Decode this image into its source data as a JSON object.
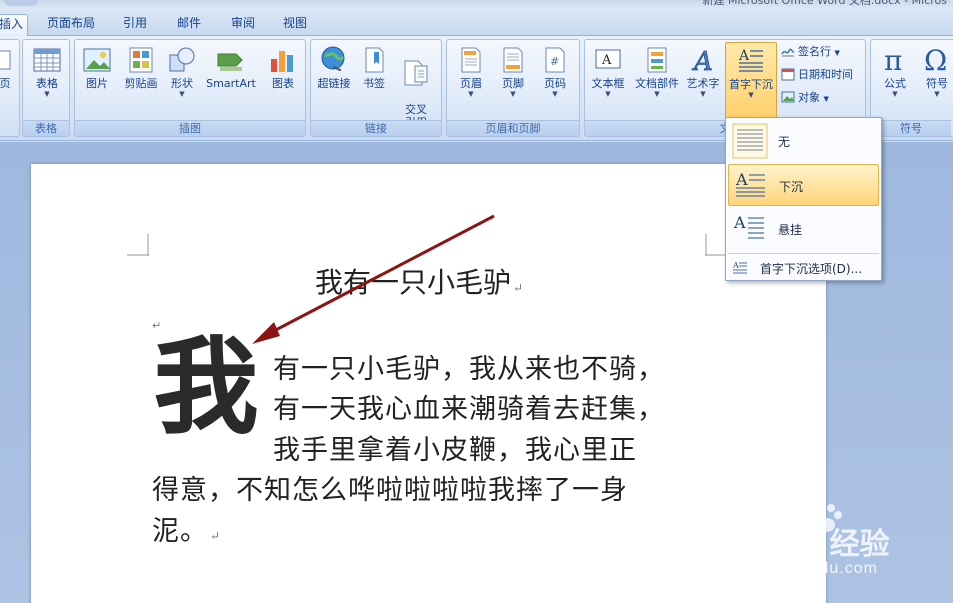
{
  "window": {
    "title": "新建 Microsoft Office Word 文档.docx - Micros"
  },
  "tabs": [
    {
      "label": "插入",
      "active": true
    },
    {
      "label": "页面布局"
    },
    {
      "label": "引用"
    },
    {
      "label": "邮件"
    },
    {
      "label": "审阅"
    },
    {
      "label": "视图"
    }
  ],
  "ribbon": {
    "groups": {
      "table": {
        "label": "表格",
        "buttons": [
          "表格"
        ]
      },
      "illustrations": {
        "label": "插图",
        "buttons": [
          "图片",
          "剪贴画",
          "形状",
          "SmartArt",
          "图表"
        ]
      },
      "links": {
        "label": "链接",
        "buttons": [
          "超链接",
          "书签",
          "交叉\n引用"
        ]
      },
      "header_footer": {
        "label": "页眉和页脚",
        "buttons": [
          "页眉",
          "页脚",
          "页码"
        ]
      },
      "text": {
        "label": "文",
        "buttons": [
          "文本框",
          "文档部件",
          "艺术字",
          "首字下沉"
        ],
        "small": [
          "签名行",
          "日期和时间",
          "对象"
        ]
      },
      "symbols": {
        "label": "符号",
        "buttons": [
          "公式",
          "符号"
        ]
      }
    },
    "left_partial": "页"
  },
  "dropcap_menu": {
    "items": [
      {
        "label": "无"
      },
      {
        "label": "下沉",
        "selected": true
      },
      {
        "label": "悬挂"
      }
    ],
    "options": "首字下沉选项(D)..."
  },
  "document": {
    "title": "我有一只小毛驴",
    "dropcap": "我",
    "lines": [
      "有一只小毛驴，我从来也不骑，",
      "有一天我心血来潮骑着去赶集，",
      "我手里拿着小皮鞭，我心里正",
      "得意，不知怎么哗啦啦啦啦我摔了一身",
      "泥。"
    ],
    "para_mark": "↵"
  },
  "watermark": {
    "main": "Baidu 经验",
    "sub": "jingyan.baidu.com"
  },
  "colors": {
    "accent": "#15428b",
    "arrow": "#8b1515",
    "highlight": "#ffd57a"
  }
}
